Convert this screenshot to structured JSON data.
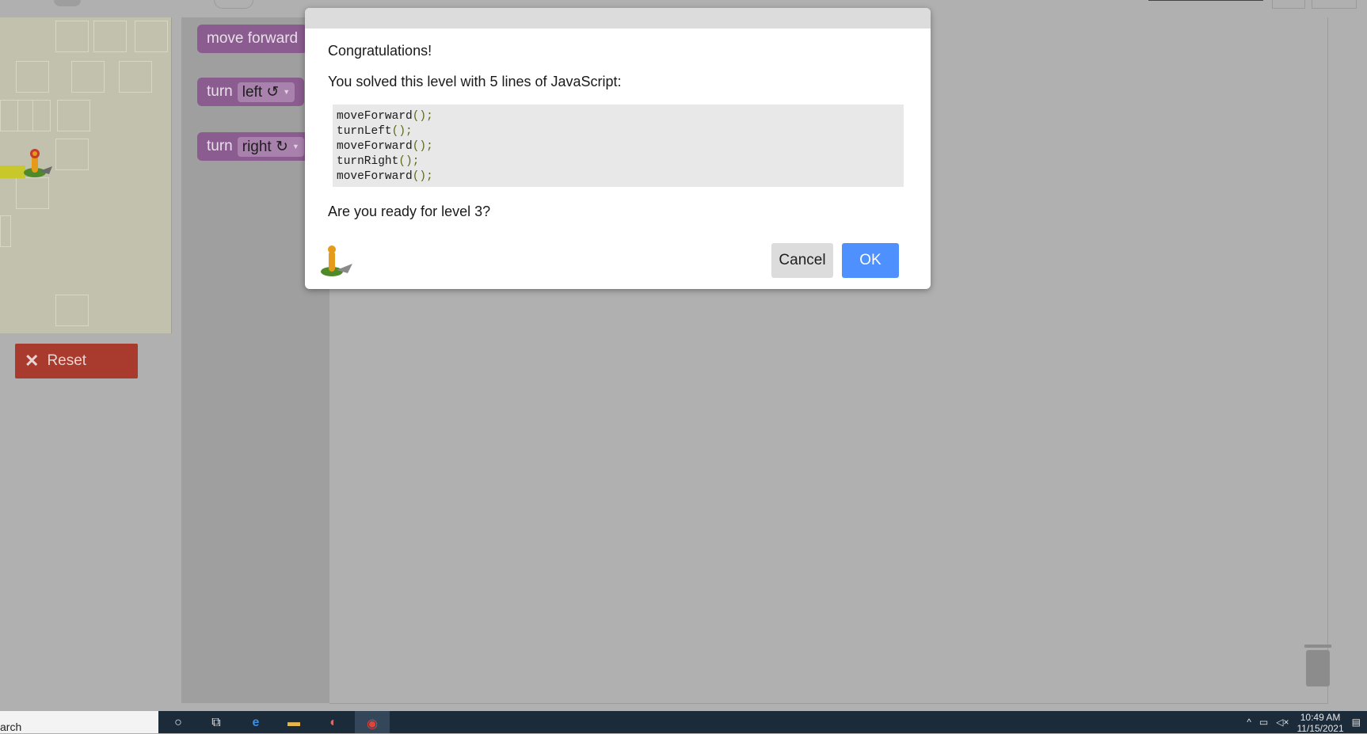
{
  "toolbox": {
    "move_forward": "move forward",
    "turn_left": {
      "keyword": "turn",
      "value": "left ↺"
    },
    "turn_right": {
      "keyword": "turn",
      "value": "right ↻"
    }
  },
  "reset": {
    "label": "Reset"
  },
  "dialog": {
    "title": "Congratulations!",
    "message": "You solved this level with 5 lines of JavaScript:",
    "code": [
      "moveForward",
      "turnLeft",
      "moveForward",
      "turnRight",
      "moveForward"
    ],
    "code_suffix": "();",
    "question": "Are you ready for level 3?",
    "cancel_label": "Cancel",
    "ok_label": "OK"
  },
  "taskbar": {
    "search_text": "arch",
    "time": "10:49 AM",
    "date": "11/15/2021"
  },
  "colors": {
    "block": "#8a5c8f",
    "reset": "#a83a2e",
    "ok": "#4d90fe"
  }
}
